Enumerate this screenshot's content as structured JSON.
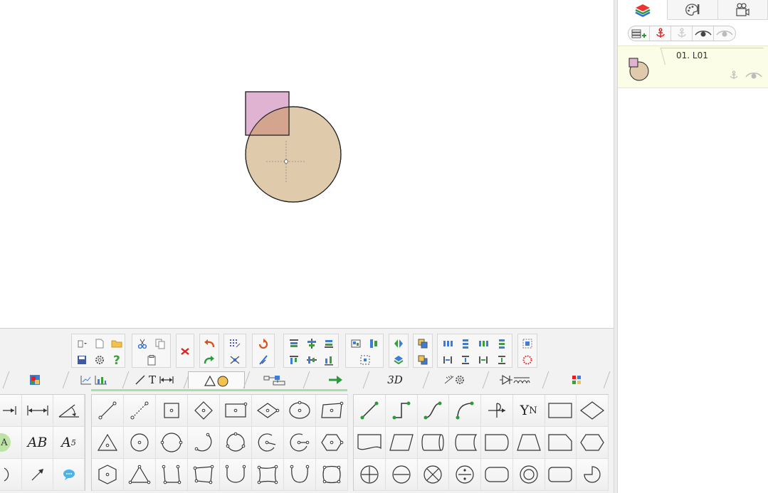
{
  "canvas": {
    "shapes": [
      {
        "kind": "circle",
        "fill": "#dfcbab",
        "stroke": "#222222"
      },
      {
        "kind": "square",
        "fill": "#e0b3d3",
        "overlap_fill": "#d4a58e",
        "stroke": "#222222"
      }
    ]
  },
  "right_panel": {
    "tabs": [
      {
        "icon": "layers-icon",
        "active": true
      },
      {
        "icon": "palette-icon",
        "active": false
      },
      {
        "icon": "camera-icon",
        "active": false
      }
    ],
    "layer_toolbar": [
      "add-layer-icon",
      "anchor-icon",
      "anchor-disabled-icon",
      "eye-icon",
      "eye-disabled-icon"
    ],
    "layers": [
      {
        "name": "01. L01"
      }
    ]
  },
  "bottom_panel": {
    "tabs": [
      {
        "icon": "image-icon"
      },
      {
        "icon": "chart-icon"
      },
      {
        "label": "T",
        "icon": "line-text-dimension-icon"
      },
      {
        "icon": "triangle-circle-icon",
        "active": true
      },
      {
        "icon": "flowchart-icon"
      },
      {
        "icon": "arrow-icon"
      },
      {
        "label": "3D"
      },
      {
        "icon": "gear-icon"
      },
      {
        "icon": "electrical-icon"
      },
      {
        "icon": "grid-icon"
      }
    ],
    "left_column": {
      "ab_label": "AB",
      "a5_label": "A",
      "a5_subscript": "5",
      "a_label": "A"
    },
    "flow_grid": {
      "yn_label": "Y",
      "yn_subscript": "N"
    }
  }
}
